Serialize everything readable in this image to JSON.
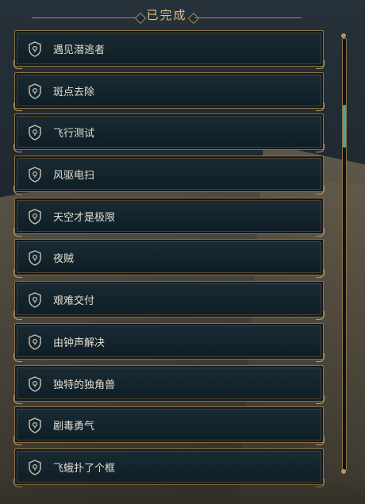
{
  "header": {
    "title": "已完成"
  },
  "quests": [
    {
      "label": "遇见潜逃者",
      "icon": "shield-icon"
    },
    {
      "label": "斑点去除",
      "icon": "shield-icon"
    },
    {
      "label": "飞行测试",
      "icon": "shield-icon"
    },
    {
      "label": "风驱电扫",
      "icon": "shield-icon"
    },
    {
      "label": "天空才是极限",
      "icon": "shield-icon"
    },
    {
      "label": "夜贼",
      "icon": "shield-icon"
    },
    {
      "label": "艰难交付",
      "icon": "shield-icon"
    },
    {
      "label": "由钟声解决",
      "icon": "shield-icon"
    },
    {
      "label": "独特的独角兽",
      "icon": "shield-icon"
    },
    {
      "label": "剧毒勇气",
      "icon": "shield-icon"
    },
    {
      "label": "飞蛾扑了个框",
      "icon": "shield-icon"
    }
  ],
  "scroll": {
    "position": 0.17,
    "visible_fraction": 0.1
  },
  "colors": {
    "accent_gold": "#d9c08e",
    "frame": "#8c734a",
    "scroll_thumb": "#4aa69b"
  }
}
